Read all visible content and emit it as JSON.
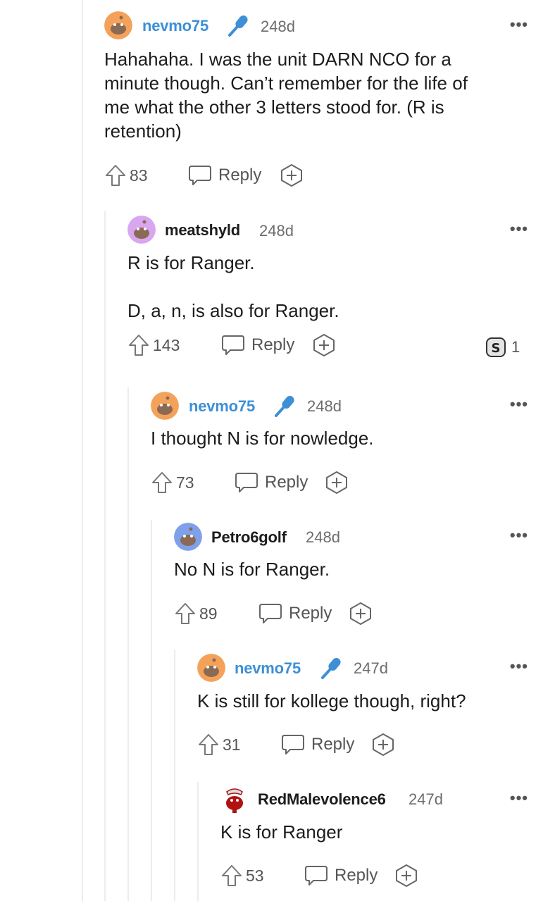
{
  "comments": [
    {
      "username": "nevmo75",
      "is_op": true,
      "age": "248d",
      "body": "Hahahaha. I was the unit DARN NCO for a\nminute though. Can’t remember for the life of\nme what the other 3 letters stood for. (R is\nretention)",
      "score": "83",
      "reply_label": "Reply",
      "more_label": "•••",
      "avatar_color": "#f4a25a"
    },
    {
      "username": "meatshyld",
      "is_op": false,
      "age": "248d",
      "body": "R is for Ranger.\n\nD, a, n, is also for Ranger.",
      "score": "143",
      "reply_label": "Reply",
      "more_label": "•••",
      "award_count": "1",
      "avatar_color": "#d9a6f0"
    },
    {
      "username": "nevmo75",
      "is_op": true,
      "age": "248d",
      "body": "I thought N is for nowledge.",
      "score": "73",
      "reply_label": "Reply",
      "more_label": "•••",
      "avatar_color": "#f4a25a"
    },
    {
      "username": "Petro6golf",
      "is_op": false,
      "age": "248d",
      "body": "No N is for Ranger.",
      "score": "89",
      "reply_label": "Reply",
      "more_label": "•••",
      "avatar_color": "#7fa1ea"
    },
    {
      "username": "nevmo75",
      "is_op": true,
      "age": "247d",
      "body": "K is still for kollege though, right?",
      "score": "31",
      "reply_label": "Reply",
      "more_label": "•••",
      "avatar_color": "#f4a25a"
    },
    {
      "username": "RedMalevolence6",
      "is_op": false,
      "age": "247d",
      "body": "K is for Ranger",
      "score": "53",
      "reply_label": "Reply",
      "more_label": "•••",
      "avatar_color": "#b01212"
    }
  ],
  "colors": {
    "op_username": "#3d8fd6",
    "mic": "#3d8fd6",
    "thread_line": "#ececec"
  },
  "icons": [
    "upvote-icon",
    "reply-bubble-icon",
    "award-plus-icon",
    "microphone-icon",
    "silver-award-icon",
    "more-icon"
  ]
}
